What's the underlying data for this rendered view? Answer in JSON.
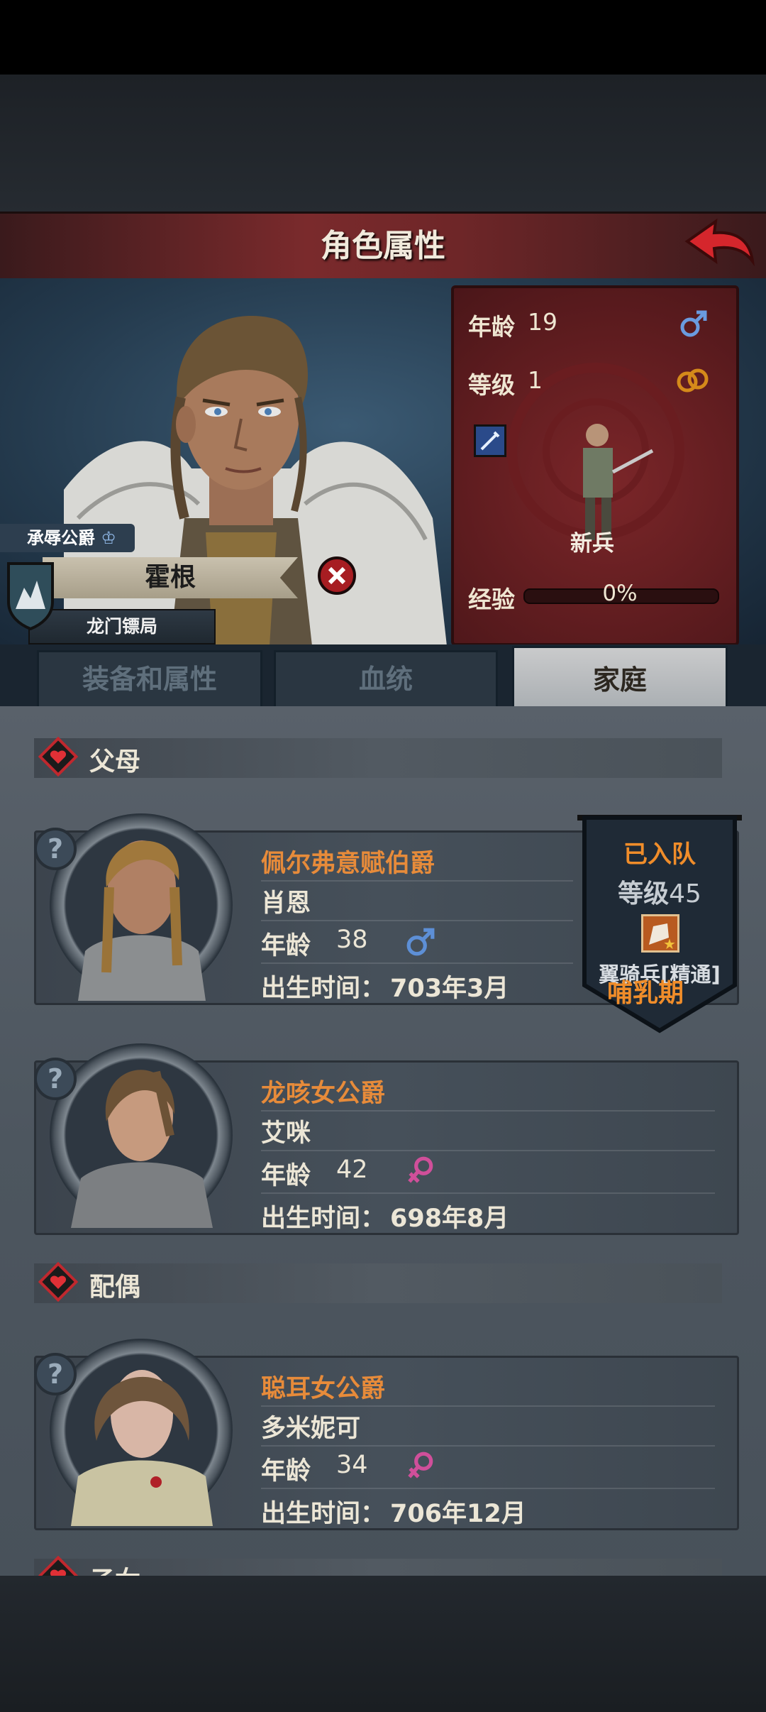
{
  "header": {
    "title": "角色属性"
  },
  "character": {
    "title_tag": "承辱公爵",
    "name": "霍根",
    "group": "龙门镖局",
    "age_label": "年龄",
    "age": "19",
    "level_label": "等级",
    "level": "1",
    "unit_name": "新兵",
    "exp_label": "经验",
    "exp_text": "0%",
    "exp_value": 0,
    "gender": "male"
  },
  "tabs": [
    {
      "label": "装备和属性",
      "active": false
    },
    {
      "label": "血统",
      "active": false
    },
    {
      "label": "家庭",
      "active": true
    }
  ],
  "sections": {
    "parents": "父母",
    "spouse": "配偶",
    "children": "子女"
  },
  "family": [
    {
      "rank": "佩尔弗意赋伯爵",
      "name": "肖恩",
      "age_label": "年龄",
      "age": "38",
      "gender": "male",
      "birth_label": "出生时间：",
      "birth": "703年3月"
    },
    {
      "rank": "龙咳女公爵",
      "name": "艾咪",
      "age_label": "年龄",
      "age": "42",
      "gender": "female",
      "birth_label": "出生时间：",
      "birth": "698年8月"
    },
    {
      "rank": "聪耳女公爵",
      "name": "多米妮可",
      "age_label": "年龄",
      "age": "34",
      "gender": "female",
      "birth_label": "出生时间：",
      "birth": "706年12月",
      "status": "哺乳期"
    }
  ],
  "joined_flag": {
    "status": "已入队",
    "level_label": "等级",
    "level": "45",
    "class": "翼骑兵[精通]"
  },
  "help_symbol": "?",
  "colors": {
    "accent_orange": "#e78b3a",
    "male_blue": "#5d8fd6",
    "female_pink": "#d04f9a",
    "title_red": "#7a2a2c"
  }
}
